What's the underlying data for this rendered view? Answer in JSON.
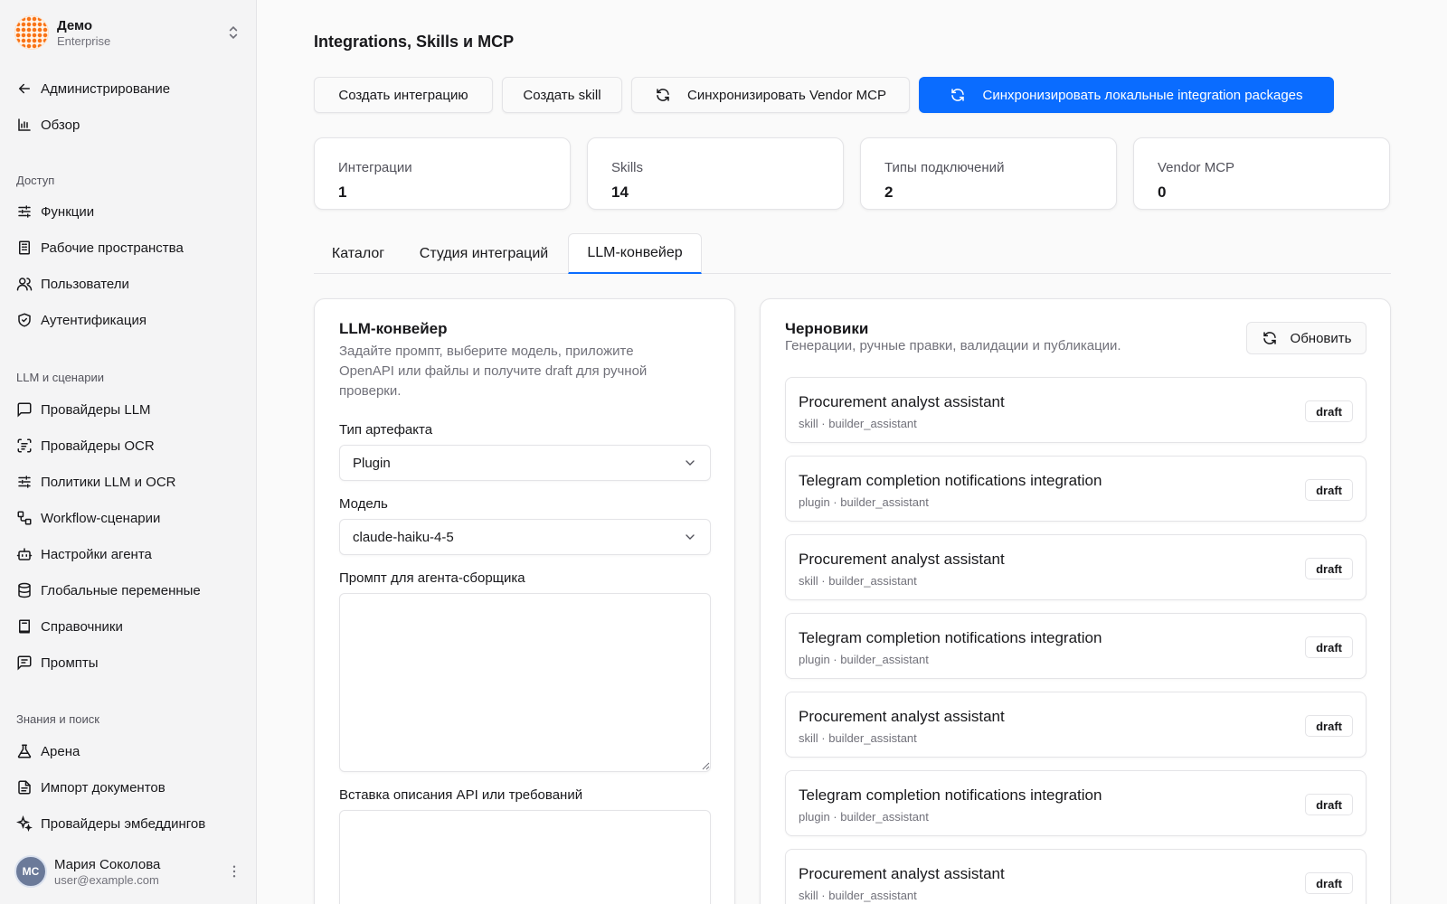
{
  "brand": {
    "name": "Демо",
    "plan": "Enterprise"
  },
  "nav": {
    "back": "Администрирование",
    "overview": "Обзор",
    "section_access": "Доступ",
    "functions": "Функции",
    "workspaces": "Рабочие пространства",
    "users": "Пользователи",
    "auth": "Аутентификация",
    "section_llm": "LLM и сценарии",
    "llm_providers": "Провайдеры LLM",
    "ocr_providers": "Провайдеры OCR",
    "llm_ocr_policies": "Политики LLM и OCR",
    "workflows": "Workflow-сценарии",
    "agent_settings": "Настройки агента",
    "global_vars": "Глобальные переменные",
    "dictionaries": "Справочники",
    "prompts": "Промпты",
    "section_knowledge": "Знания и поиск",
    "arena": "Арена",
    "doc_import": "Импорт документов",
    "embedding_providers": "Провайдеры эмбеддингов"
  },
  "user": {
    "initials": "МС",
    "name": "Мария Соколова",
    "email": "user@example.com"
  },
  "page": {
    "title": "Integrations, Skills и MCP"
  },
  "actions": {
    "create_integration": "Создать интеграцию",
    "create_skill": "Создать skill",
    "sync_vendor": "Синхронизировать Vendor MCP",
    "sync_local": "Синхронизировать локальные integration packages"
  },
  "stats": [
    {
      "label": "Интеграции",
      "value": "1"
    },
    {
      "label": "Skills",
      "value": "14"
    },
    {
      "label": "Типы подключений",
      "value": "2"
    },
    {
      "label": "Vendor MCP",
      "value": "0"
    }
  ],
  "tabs": {
    "catalog": "Каталог",
    "studio": "Студия интеграций",
    "pipeline": "LLM-конвейер"
  },
  "pipeline": {
    "title": "LLM-конвейер",
    "desc_line1": "Задайте промпт, выберите модель, приложите",
    "desc_line2": "OpenAPI или файлы и получите draft для ручной",
    "desc_line3": "проверки.",
    "artifact_label": "Тип артефакта",
    "artifact_value": "Plugin",
    "model_label": "Модель",
    "model_value": "claude-haiku-4-5",
    "prompt_label": "Промпт для агента-сборщика",
    "prompt_value": "",
    "api_label": "Вставка описания API или требований",
    "api_value": ""
  },
  "drafts": {
    "title": "Черновики",
    "subtitle": "Генерации, ручные правки, валидации и публикации.",
    "refresh": "Обновить",
    "items": [
      {
        "title": "Procurement analyst assistant",
        "meta": "skill · builder_assistant",
        "status": "draft"
      },
      {
        "title": "Telegram completion notifications integration",
        "meta": "plugin · builder_assistant",
        "status": "draft"
      },
      {
        "title": "Procurement analyst assistant",
        "meta": "skill · builder_assistant",
        "status": "draft"
      },
      {
        "title": "Telegram completion notifications integration",
        "meta": "plugin · builder_assistant",
        "status": "draft"
      },
      {
        "title": "Procurement analyst assistant",
        "meta": "skill · builder_assistant",
        "status": "draft"
      },
      {
        "title": "Telegram completion notifications integration",
        "meta": "plugin · builder_assistant",
        "status": "draft"
      },
      {
        "title": "Procurement analyst assistant",
        "meta": "skill · builder_assistant",
        "status": "draft"
      }
    ]
  },
  "colors": {
    "accent": "#0a6cff",
    "sidebar_bg": "#f4f4f5",
    "border": "#e4e4e7"
  }
}
